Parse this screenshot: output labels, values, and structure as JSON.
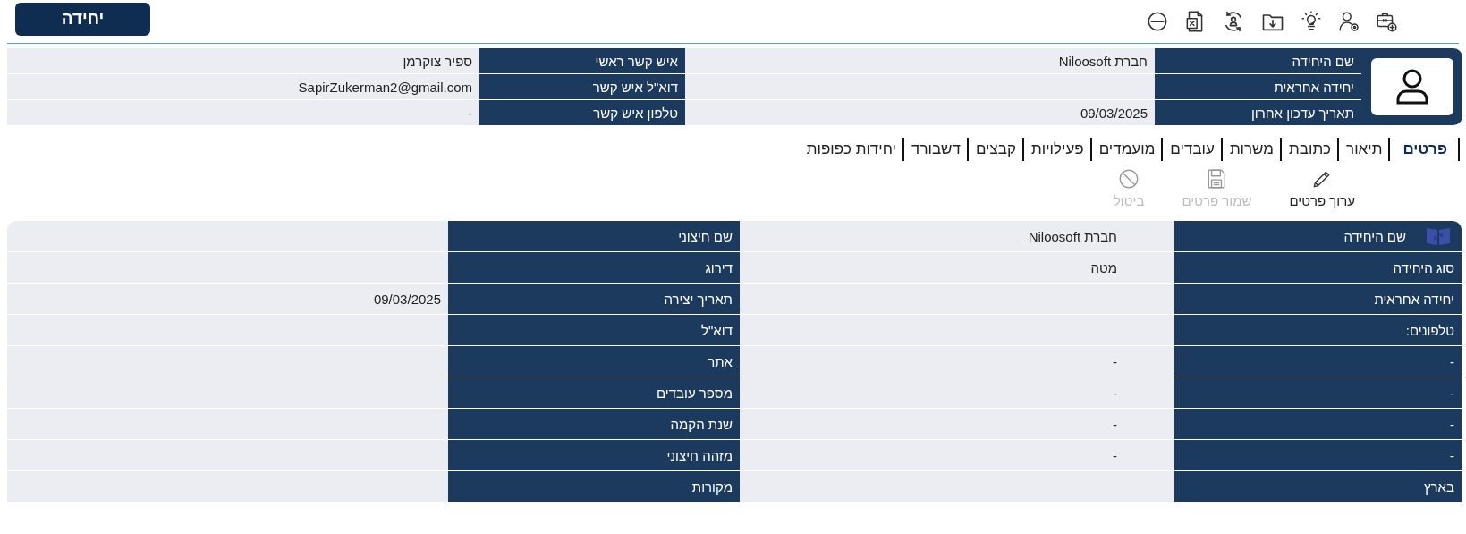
{
  "unit_button": "יחידה",
  "summary": {
    "rows": [
      {
        "label": "שם היחידה",
        "value": "חברת Niloosoft",
        "contact_label": "איש קשר ראשי",
        "contact_value": "ספיר צוקרמן"
      },
      {
        "label": "יחידה אחראית",
        "contact_label": "דוא\"ל איש קשר",
        "contact_value": "SapirZukerman2@gmail.com"
      },
      {
        "label": "תאריך עדכון אחרון",
        "value": "09/03/2025",
        "contact_label": "טלפון איש קשר",
        "contact_value": "-"
      }
    ]
  },
  "tabs": [
    {
      "label": "פרטים",
      "selected": true
    },
    {
      "label": "תיאור",
      "selected": false
    },
    {
      "label": "כתובת",
      "selected": false
    },
    {
      "label": "משרות",
      "selected": false
    },
    {
      "label": "עובדים",
      "selected": false
    },
    {
      "label": "מועמדים",
      "selected": false
    },
    {
      "label": "פעילויות",
      "selected": false
    },
    {
      "label": "קבצים",
      "selected": false
    },
    {
      "label": "דשבורד",
      "selected": false
    },
    {
      "label": "יחידות כפופות",
      "selected": false
    }
  ],
  "actions": [
    {
      "kind": "edit",
      "label": "ערוך פרטים",
      "disabled": false
    },
    {
      "kind": "save",
      "label": "שמור פרטים",
      "disabled": true
    },
    {
      "kind": "cancel",
      "label": "ביטול",
      "disabled": true
    }
  ],
  "details": {
    "rows": [
      {
        "label": "שם היחידה",
        "value": "חברת Niloosoft",
        "side_label": "שם חיצוני"
      },
      {
        "label": "סוג היחידה",
        "value": "מטה",
        "side_label": "דירוג"
      },
      {
        "label": "יחידה אחראית",
        "side_label": "תאריך יצירה",
        "side_value": "09/03/2025"
      },
      {
        "label": "טלפונים:",
        "side_label": "דוא\"ל"
      },
      {
        "label": "-",
        "value": "-",
        "side_label": "אתר"
      },
      {
        "label": "-",
        "value": "-",
        "side_label": "מספר עובדים"
      },
      {
        "label": "-",
        "value": "-",
        "side_label": "שנת הקמה"
      },
      {
        "label": "-",
        "value": "-",
        "side_label": "מזהה חיצוני"
      },
      {
        "label": "בארץ",
        "side_label": "מקורות"
      }
    ]
  }
}
